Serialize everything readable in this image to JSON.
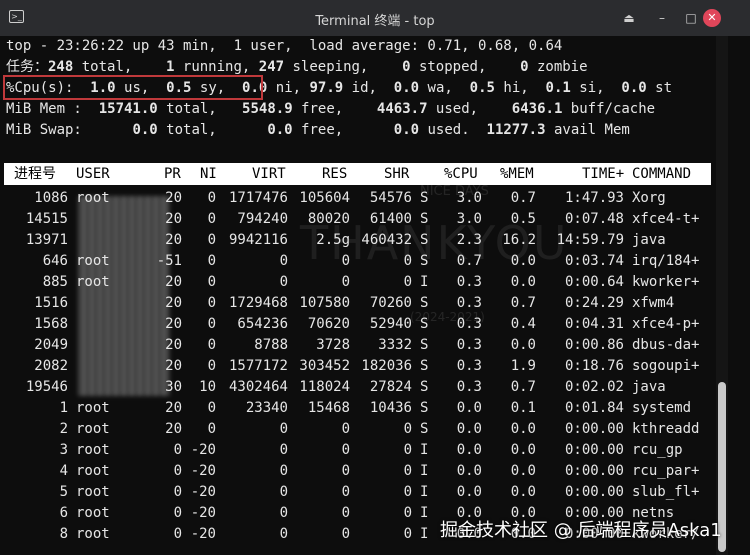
{
  "window": {
    "title": "Terminal 终端 - top",
    "icons": [
      "terminal-icon",
      "scroll-up-icon",
      "minimize-icon",
      "maximize-icon",
      "close-icon"
    ]
  },
  "summary": {
    "line1": "top - 23:26:22 up 43 min,  1 user,  load average: 0.71, 0.68, 0.64",
    "tasks": {
      "label": "任务：",
      "total": "248",
      "total_label": " total,",
      "running": "1",
      "running_label": " running,",
      "sleeping": "247",
      "sleeping_label": " sleeping,",
      "stopped": "0",
      "stopped_label": " stopped,",
      "zombie": "0",
      "zombie_label": " zombie"
    },
    "cpu": {
      "label": "%Cpu(s):",
      "us": "1.0",
      "us_label": " us,",
      "sy": "0.5",
      "sy_label": " sy,",
      "ni": "0.0",
      "ni_label": " ni,",
      "id": "97.9",
      "id_label": " id,",
      "wa": "0.0",
      "wa_label": " wa,",
      "hi": "0.5",
      "hi_label": " hi,",
      "si": "0.1",
      "si_label": " si,",
      "st": "0.0",
      "st_label": " st"
    },
    "mem": {
      "label": "MiB Mem :",
      "total": "15741.0",
      "total_label": " total,",
      "free": "5548.9",
      "free_label": " free,",
      "used": "4463.7",
      "used_label": " used,",
      "buff": "6436.1",
      "buff_label": " buff/cache"
    },
    "swap": {
      "label": "MiB Swap:",
      "total": "0.0",
      "total_label": " total,",
      "free": "0.0",
      "free_label": " free,",
      "used": "0.0",
      "used_label": " used.",
      "avail": "11277.3",
      "avail_label": " avail Mem"
    }
  },
  "columns": [
    "进程号",
    "USER",
    "PR",
    "NI",
    "VIRT",
    "RES",
    "SHR",
    "",
    "%CPU",
    "%MEM",
    "TIME+",
    "COMMAND"
  ],
  "processes": [
    {
      "pid": "1086",
      "user": "root",
      "pr": "20",
      "ni": "0",
      "virt": "1717476",
      "res": "105604",
      "shr": "54576",
      "s": "S",
      "cpu": "3.0",
      "mem": "0.7",
      "time": "1:47.93",
      "cmd": "Xorg"
    },
    {
      "pid": "14515",
      "user": "",
      "pr": "20",
      "ni": "0",
      "virt": "794240",
      "res": "80020",
      "shr": "61400",
      "s": "S",
      "cpu": "3.0",
      "mem": "0.5",
      "time": "0:07.48",
      "cmd": "xfce4-t+"
    },
    {
      "pid": "13971",
      "user": "",
      "pr": "20",
      "ni": "0",
      "virt": "9942116",
      "res": "2.5g",
      "shr": "460432",
      "s": "S",
      "cpu": "2.3",
      "mem": "16.2",
      "time": "14:59.79",
      "cmd": "java"
    },
    {
      "pid": "646",
      "user": "root",
      "pr": "-51",
      "ni": "0",
      "virt": "0",
      "res": "0",
      "shr": "0",
      "s": "S",
      "cpu": "0.7",
      "mem": "0.0",
      "time": "0:03.74",
      "cmd": "irq/184+"
    },
    {
      "pid": "885",
      "user": "root",
      "pr": "20",
      "ni": "0",
      "virt": "0",
      "res": "0",
      "shr": "0",
      "s": "I",
      "cpu": "0.3",
      "mem": "0.0",
      "time": "0:00.64",
      "cmd": "kworker+"
    },
    {
      "pid": "1516",
      "user": "",
      "pr": "20",
      "ni": "0",
      "virt": "1729468",
      "res": "107580",
      "shr": "70260",
      "s": "S",
      "cpu": "0.3",
      "mem": "0.7",
      "time": "0:24.29",
      "cmd": "xfwm4"
    },
    {
      "pid": "1568",
      "user": "",
      "pr": "20",
      "ni": "0",
      "virt": "654236",
      "res": "70620",
      "shr": "52940",
      "s": "S",
      "cpu": "0.3",
      "mem": "0.4",
      "time": "0:04.31",
      "cmd": "xfce4-p+"
    },
    {
      "pid": "2049",
      "user": "",
      "pr": "20",
      "ni": "0",
      "virt": "8788",
      "res": "3728",
      "shr": "3332",
      "s": "S",
      "cpu": "0.3",
      "mem": "0.0",
      "time": "0:00.86",
      "cmd": "dbus-da+"
    },
    {
      "pid": "2082",
      "user": "",
      "pr": "20",
      "ni": "0",
      "virt": "1577172",
      "res": "303452",
      "shr": "182036",
      "s": "S",
      "cpu": "0.3",
      "mem": "1.9",
      "time": "0:18.76",
      "cmd": "sogoupi+"
    },
    {
      "pid": "19546",
      "user": "",
      "pr": "30",
      "ni": "10",
      "virt": "4302464",
      "res": "118024",
      "shr": "27824",
      "s": "S",
      "cpu": "0.3",
      "mem": "0.7",
      "time": "0:02.02",
      "cmd": "java"
    },
    {
      "pid": "1",
      "user": "root",
      "pr": "20",
      "ni": "0",
      "virt": "23340",
      "res": "15468",
      "shr": "10436",
      "s": "S",
      "cpu": "0.0",
      "mem": "0.1",
      "time": "0:01.84",
      "cmd": "systemd"
    },
    {
      "pid": "2",
      "user": "root",
      "pr": "20",
      "ni": "0",
      "virt": "0",
      "res": "0",
      "shr": "0",
      "s": "S",
      "cpu": "0.0",
      "mem": "0.0",
      "time": "0:00.00",
      "cmd": "kthreadd"
    },
    {
      "pid": "3",
      "user": "root",
      "pr": "0",
      "ni": "-20",
      "virt": "0",
      "res": "0",
      "shr": "0",
      "s": "I",
      "cpu": "0.0",
      "mem": "0.0",
      "time": "0:00.00",
      "cmd": "rcu_gp"
    },
    {
      "pid": "4",
      "user": "root",
      "pr": "0",
      "ni": "-20",
      "virt": "0",
      "res": "0",
      "shr": "0",
      "s": "I",
      "cpu": "0.0",
      "mem": "0.0",
      "time": "0:00.00",
      "cmd": "rcu_par+"
    },
    {
      "pid": "5",
      "user": "root",
      "pr": "0",
      "ni": "-20",
      "virt": "0",
      "res": "0",
      "shr": "0",
      "s": "I",
      "cpu": "0.0",
      "mem": "0.0",
      "time": "0:00.00",
      "cmd": "slub_fl+"
    },
    {
      "pid": "6",
      "user": "root",
      "pr": "0",
      "ni": "-20",
      "virt": "0",
      "res": "0",
      "shr": "0",
      "s": "I",
      "cpu": "0.0",
      "mem": "0.0",
      "time": "0:00.00",
      "cmd": "netns"
    },
    {
      "pid": "8",
      "user": "root",
      "pr": "0",
      "ni": "-20",
      "virt": "0",
      "res": "0",
      "shr": "0",
      "s": "I",
      "cpu": "0.0",
      "mem": "0.0",
      "time": "0:00.00",
      "cmd": "kworker/"
    }
  ],
  "watermark": {
    "corner": "掘金技术社区 @ 后端程序员Aska1",
    "bg_big": "THANKYOU",
    "bg_small1": "NICE DAYS",
    "bg_small2": "(2024-2021)"
  }
}
